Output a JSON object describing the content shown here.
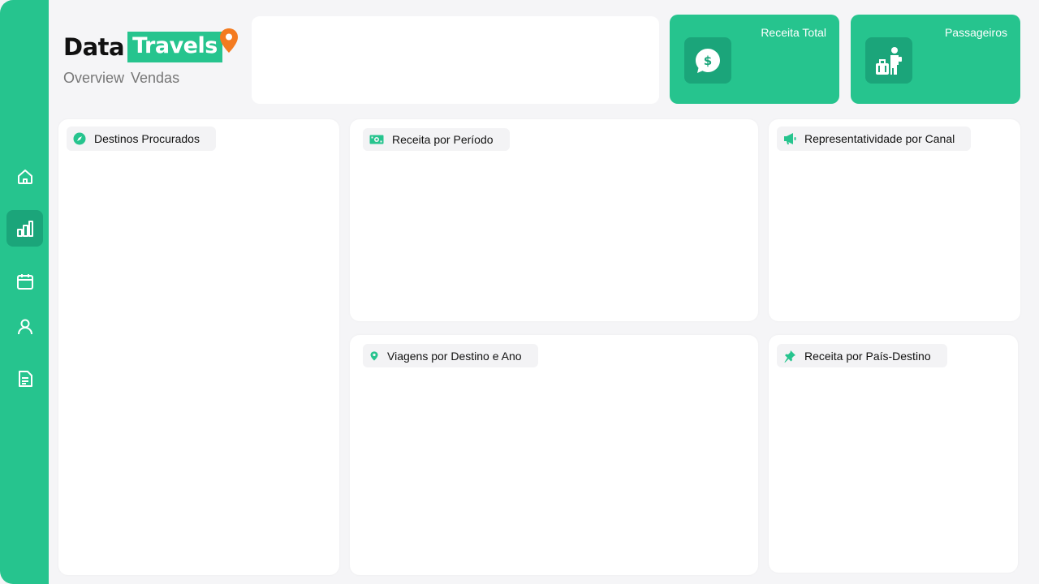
{
  "brand": {
    "part1": "Data",
    "part2": "Travels",
    "subtitle": "Overview Vendas",
    "accent_color": "#26c48e",
    "accent_dark": "#1ba57a",
    "pin_color": "#f47b20"
  },
  "sidebar": {
    "items": [
      {
        "icon": "home-icon",
        "active": false
      },
      {
        "icon": "bar-chart-icon",
        "active": true
      },
      {
        "icon": "calendar-icon",
        "active": false
      },
      {
        "icon": "user-icon",
        "active": false
      },
      {
        "icon": "document-icon",
        "active": false
      }
    ]
  },
  "kpis": [
    {
      "title": "Receita Total",
      "icon": "dollar-chat-icon"
    },
    {
      "title": "Passageiros",
      "icon": "traveler-luggage-icon"
    }
  ],
  "cards": {
    "destinos": {
      "title": "Destinos Procurados",
      "icon": "compass-icon"
    },
    "receita_periodo": {
      "title": "Receita por Período",
      "icon": "money-bill-icon"
    },
    "canal": {
      "title": "Representatividade por Canal",
      "icon": "megaphone-icon"
    },
    "viagens": {
      "title": "Viagens por Destino e Ano",
      "icon": "map-pin-icon"
    },
    "pais": {
      "title": "Receita por País-Destino",
      "icon": "pushpin-icon"
    }
  }
}
